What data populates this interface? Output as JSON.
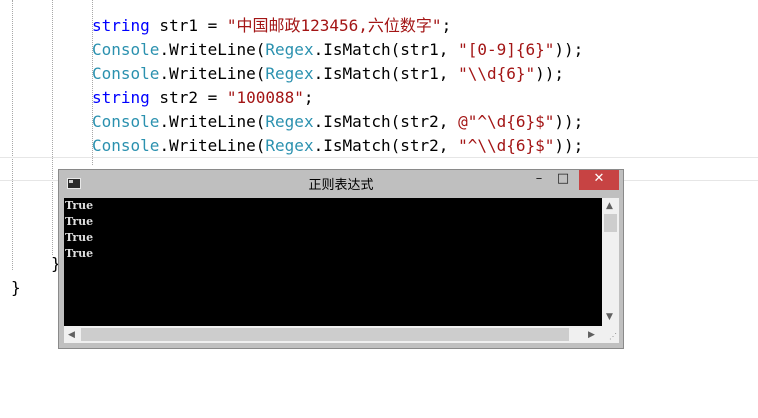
{
  "code": {
    "line1": {
      "type": "string",
      "rest": " str1 = ",
      "literal": "\"中国邮政123456,六位数字\"",
      "end": ";"
    },
    "line2": {
      "cls": "Console",
      "mid": ".WriteLine(",
      "cls2": "Regex",
      "mid2": ".IsMatch(str1, ",
      "literal": "\"[0-9]{6}\"",
      "end": "));"
    },
    "line3": {
      "cls": "Console",
      "mid": ".WriteLine(",
      "cls2": "Regex",
      "mid2": ".IsMatch(str1, ",
      "literal": "\"\\\\d{6}\"",
      "end": "));"
    },
    "line4": {
      "type": "string",
      "rest": " str2 = ",
      "literal": "\"100088\"",
      "end": ";"
    },
    "line5": {
      "cls": "Console",
      "mid": ".WriteLine(",
      "cls2": "Regex",
      "mid2": ".IsMatch(str2, ",
      "literal": "@\"^\\d{6}$\"",
      "end": "));"
    },
    "line6": {
      "cls": "Console",
      "mid": ".WriteLine(",
      "cls2": "Regex",
      "mid2": ".IsMatch(str2, ",
      "literal": "\"^\\\\d{6}$\"",
      "end": "));"
    },
    "inner_brace": "}",
    "outer_brace": "}"
  },
  "console": {
    "title": "正则表达式",
    "minimize": "–",
    "maximize": "□",
    "close": "✕",
    "output": [
      "True",
      "True",
      "True",
      "True"
    ]
  },
  "colors": {
    "keyword": "#0000ff",
    "type": "#2b91af",
    "string": "#a31515",
    "close_button": "#c74343"
  }
}
